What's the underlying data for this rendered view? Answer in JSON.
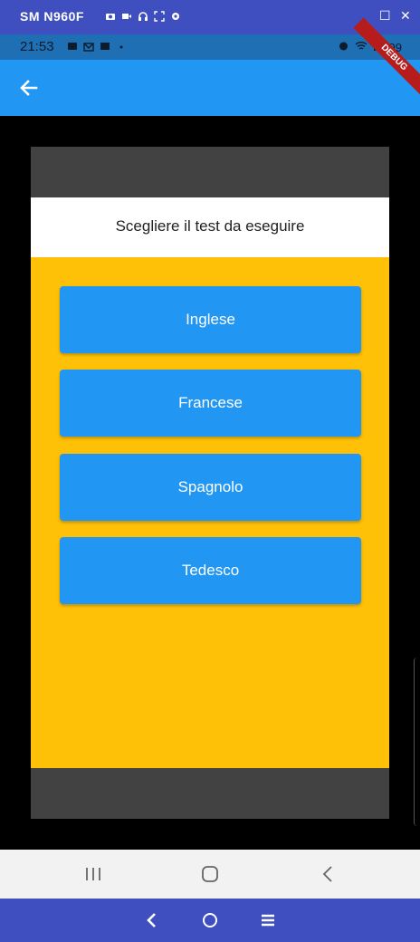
{
  "window": {
    "title": "SM N960F",
    "controls": {
      "minimize": "_",
      "maximize": "☐",
      "close": "✕"
    }
  },
  "status_bar": {
    "time": "21:53",
    "battery": "99"
  },
  "app_bar": {
    "back_icon": "arrow-left-icon"
  },
  "debug_banner": {
    "label": "DEBUG"
  },
  "card": {
    "title": "Scegliere il test da eseguire",
    "buttons": [
      {
        "label": "Inglese"
      },
      {
        "label": "Francese"
      },
      {
        "label": "Spagnolo"
      },
      {
        "label": "Tedesco"
      }
    ]
  },
  "colors": {
    "primary": "#2196f3",
    "body_bg": "#ffc107",
    "frame": "#424242",
    "emulator_bar": "#3f4fbf"
  }
}
